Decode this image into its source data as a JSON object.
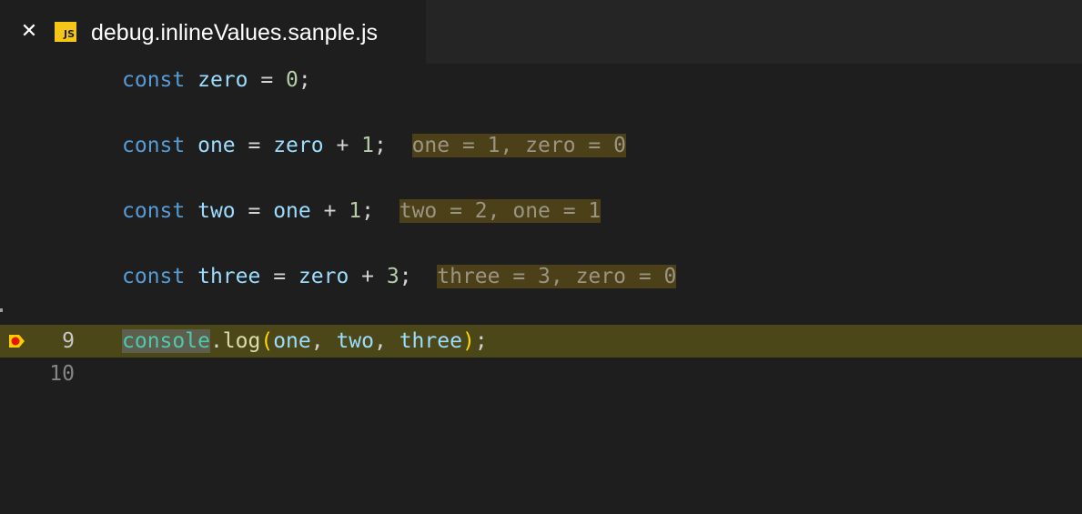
{
  "tab": {
    "close_glyph": "✕",
    "icon_label": "JS",
    "file_name": "debug.inlineValues.sanple.js"
  },
  "editor": {
    "lines": [
      {
        "number": "",
        "tokens": [
          {
            "text": "const",
            "kind": "kw"
          },
          {
            "text": " ",
            "kind": "op"
          },
          {
            "text": "zero",
            "kind": "var"
          },
          {
            "text": " = ",
            "kind": "op"
          },
          {
            "text": "0",
            "kind": "num"
          },
          {
            "text": ";",
            "kind": "op"
          }
        ],
        "inline_value": ""
      },
      {
        "number": "",
        "tokens": [
          {
            "text": "const",
            "kind": "kw"
          },
          {
            "text": " ",
            "kind": "op"
          },
          {
            "text": "one",
            "kind": "var"
          },
          {
            "text": " = ",
            "kind": "op"
          },
          {
            "text": "zero",
            "kind": "var"
          },
          {
            "text": " + ",
            "kind": "op"
          },
          {
            "text": "1",
            "kind": "num"
          },
          {
            "text": ";",
            "kind": "op"
          }
        ],
        "inline_value": "one = 1, zero = 0"
      },
      {
        "number": "",
        "tokens": [
          {
            "text": "const",
            "kind": "kw"
          },
          {
            "text": " ",
            "kind": "op"
          },
          {
            "text": "two",
            "kind": "var"
          },
          {
            "text": " = ",
            "kind": "op"
          },
          {
            "text": "one",
            "kind": "var"
          },
          {
            "text": " + ",
            "kind": "op"
          },
          {
            "text": "1",
            "kind": "num"
          },
          {
            "text": ";",
            "kind": "op"
          }
        ],
        "inline_value": "two = 2, one = 1"
      },
      {
        "number": "",
        "tokens": [
          {
            "text": "const",
            "kind": "kw"
          },
          {
            "text": " ",
            "kind": "op"
          },
          {
            "text": "three",
            "kind": "var"
          },
          {
            "text": " = ",
            "kind": "op"
          },
          {
            "text": "zero",
            "kind": "var"
          },
          {
            "text": " + ",
            "kind": "op"
          },
          {
            "text": "3",
            "kind": "num"
          },
          {
            "text": ";",
            "kind": "op"
          }
        ],
        "inline_value": "three = 3, zero = 0"
      },
      {
        "number": "9",
        "current": true,
        "breakpoint": true,
        "tokens": [
          {
            "text": "console",
            "kind": "cls",
            "highlight": true
          },
          {
            "text": ".",
            "kind": "op"
          },
          {
            "text": "log",
            "kind": "fn"
          },
          {
            "text": "(",
            "kind": "paren"
          },
          {
            "text": "one",
            "kind": "var"
          },
          {
            "text": ", ",
            "kind": "op"
          },
          {
            "text": "two",
            "kind": "var"
          },
          {
            "text": ", ",
            "kind": "op"
          },
          {
            "text": "three",
            "kind": "var"
          },
          {
            "text": ")",
            "kind": "paren"
          },
          {
            "text": ";",
            "kind": "op"
          }
        ],
        "inline_value": ""
      },
      {
        "number": "10",
        "tokens": [],
        "inline_value": ""
      }
    ]
  },
  "colors": {
    "editor_background": "#1e1e1e",
    "current_line_background": "#4b4718",
    "inline_value_background": "#4b4018",
    "breakpoint_fill": "#e51400",
    "current_frame_arrow": "#ffcc00"
  }
}
